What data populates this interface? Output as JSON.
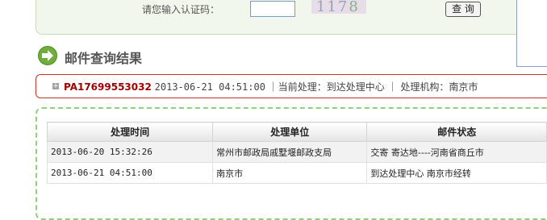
{
  "captcha": {
    "label": "请您输入认证码：",
    "input_value": "",
    "image_text": "117",
    "image_text_last": "8",
    "query_button_label": "查 询"
  },
  "section": {
    "title": "邮件查询结果",
    "icon": "arrow-right-icon"
  },
  "summary": {
    "tracking_number": "PA17699553032",
    "datetime": "2013-06-21 04:51:00",
    "current_process": "｜当前处理：到达处理中心",
    "agency": "｜ 处理机构：南京市"
  },
  "table": {
    "headers": [
      "处理时间",
      "处理单位",
      "邮件状态"
    ],
    "rows": [
      [
        "2013-06-20 15:32:26",
        "常州市邮政局戚墅堰邮政支局",
        "交寄 寄达地----河南省商丘市"
      ],
      [
        "2013-06-21 04:51:00",
        "南京市",
        "到达处理中心 南京市经转"
      ]
    ]
  }
}
